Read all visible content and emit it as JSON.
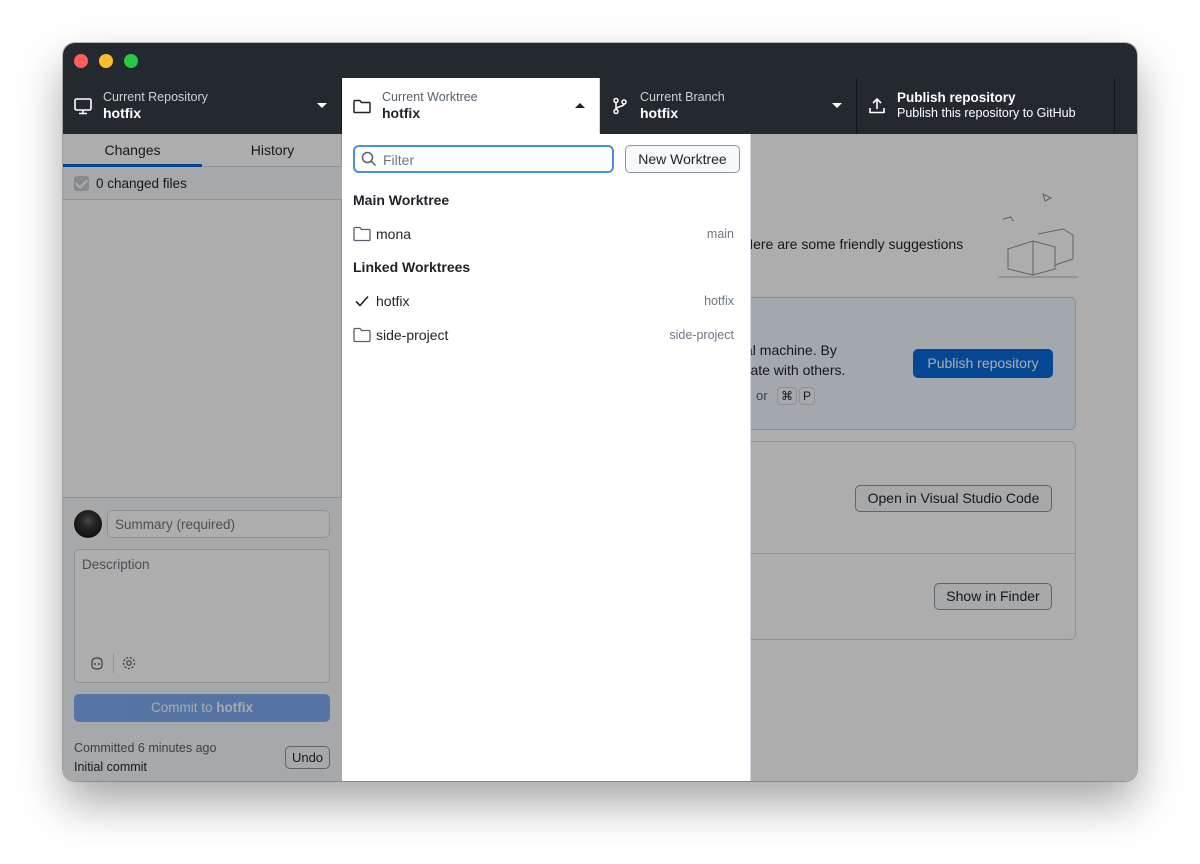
{
  "toolbar": {
    "repository": {
      "label": "Current Repository",
      "value": "hotfix"
    },
    "worktree": {
      "label": "Current Worktree",
      "value": "hotfix"
    },
    "branch": {
      "label": "Current Branch",
      "value": "hotfix"
    },
    "publish": {
      "label": "Publish repository",
      "value": "Publish this repository to GitHub"
    }
  },
  "sidebar": {
    "tabs": [
      {
        "label": "Changes",
        "active": true
      },
      {
        "label": "History",
        "active": false
      }
    ],
    "changed_files": "0 changed files",
    "commit": {
      "summary_placeholder": "Summary (required)",
      "description_placeholder": "Description",
      "button_prefix": "Commit to ",
      "button_branch": "hotfix",
      "last_commit_time": "Committed 6 minutes ago",
      "last_commit_message": "Initial commit",
      "undo_label": "Undo"
    }
  },
  "main": {
    "suggestion_text": "Here are some friendly suggestions",
    "publish_card": {
      "text_line1": "cal machine. By",
      "text_line2": "orate with others.",
      "shortcut_prefix": "or",
      "shortcut_key1": "⌘",
      "shortcut_key2": "P",
      "button_label": "Publish repository"
    },
    "open_vscode_label": "Open in Visual Studio Code",
    "show_finder_label": "Show in Finder"
  },
  "dropdown": {
    "filter_placeholder": "Filter",
    "new_worktree_label": "New Worktree",
    "main_section": "Main Worktree",
    "linked_section": "Linked Worktrees",
    "main_items": [
      {
        "name": "mona",
        "branch": "main",
        "current": false
      }
    ],
    "linked_items": [
      {
        "name": "hotfix",
        "branch": "hotfix",
        "current": true
      },
      {
        "name": "side-project",
        "branch": "side-project",
        "current": false
      }
    ]
  },
  "colors": {
    "toolbar_bg": "#24292f",
    "accent": "#0969da",
    "focus": "#4a90e2"
  }
}
